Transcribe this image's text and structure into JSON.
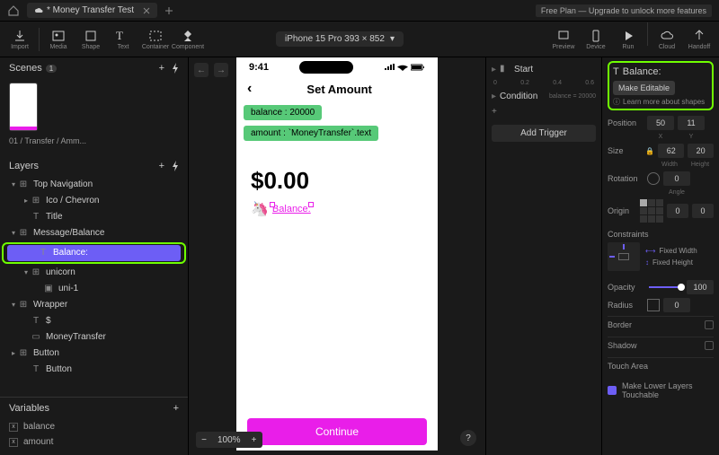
{
  "titlebar": {
    "tab_name": "* Money Transfer Test",
    "free_plan": "Free Plan — Upgrade to unlock more features"
  },
  "toolbar": {
    "items": [
      "Import",
      "Media",
      "Shape",
      "Text",
      "Container",
      "Component"
    ],
    "device": "iPhone 15 Pro  393 × 852",
    "right_items": [
      "Preview",
      "Device",
      "Run",
      "Cloud",
      "Handoff"
    ]
  },
  "scenes": {
    "header": "Scenes",
    "count": "1",
    "label": "01 / Transfer / Amm..."
  },
  "layers": {
    "header": "Layers",
    "items": [
      {
        "depth": 0,
        "caret": "▾",
        "icon": "frame",
        "label": "Top Navigation"
      },
      {
        "depth": 1,
        "caret": "▸",
        "icon": "frame",
        "label": "Ico / Chevron"
      },
      {
        "depth": 1,
        "caret": "",
        "icon": "text",
        "label": "Title"
      },
      {
        "depth": 0,
        "caret": "▾",
        "icon": "frame",
        "label": "Message/Balance"
      },
      {
        "depth": 1,
        "caret": "",
        "icon": "text",
        "label": "Balance:",
        "selected": true,
        "highlight": true
      },
      {
        "depth": 1,
        "caret": "▾",
        "icon": "frame",
        "label": "unicorn"
      },
      {
        "depth": 2,
        "caret": "",
        "icon": "image",
        "label": "uni-1"
      },
      {
        "depth": 0,
        "caret": "▾",
        "icon": "frame",
        "label": "Wrapper"
      },
      {
        "depth": 1,
        "caret": "",
        "icon": "text",
        "label": "$"
      },
      {
        "depth": 1,
        "caret": "",
        "icon": "rect",
        "label": "MoneyTransfer"
      },
      {
        "depth": 0,
        "caret": "▸",
        "icon": "frame",
        "label": "Button"
      },
      {
        "depth": 1,
        "caret": "",
        "icon": "text",
        "label": "Button"
      }
    ]
  },
  "variables": {
    "header": "Variables",
    "items": [
      "balance",
      "amount"
    ]
  },
  "canvas": {
    "time": "9:41",
    "header_title": "Set Amount",
    "box1": "balance : 20000",
    "box2": "amount : `MoneyTransfer`.text",
    "amount": "$0.00",
    "balance_label": "Balance:",
    "continue": "Continue",
    "zoom": "100%"
  },
  "mid": {
    "start": "Start",
    "condition": "Condition",
    "ruler": [
      "0",
      "0.2",
      "0.4",
      "0.6"
    ],
    "balance_eq": "balance = 20000",
    "add_trigger": "Add Trigger"
  },
  "right": {
    "title": "Balance:",
    "make_editable": "Make Editable",
    "learn": "Learn more about shapes",
    "position_lbl": "Position",
    "pos_x": "50",
    "pos_y": "11",
    "x_lbl": "X",
    "y_lbl": "Y",
    "size_lbl": "Size",
    "size_w": "62",
    "size_h": "20",
    "w_lbl": "Width",
    "h_lbl": "Height",
    "rot_lbl": "Rotation",
    "rot_v": "0",
    "angle_lbl": "Angle",
    "origin_lbl": "Origin",
    "origin_x": "0",
    "origin_y": "0",
    "constraints_lbl": "Constraints",
    "fixed_w": "Fixed Width",
    "fixed_h": "Fixed Height",
    "opacity_lbl": "Opacity",
    "opacity_v": "100",
    "radius_lbl": "Radius",
    "radius_v": "0",
    "border_lbl": "Border",
    "shadow_lbl": "Shadow",
    "touch_lbl": "Touch Area",
    "lower_touch": "Make Lower Layers Touchable"
  }
}
